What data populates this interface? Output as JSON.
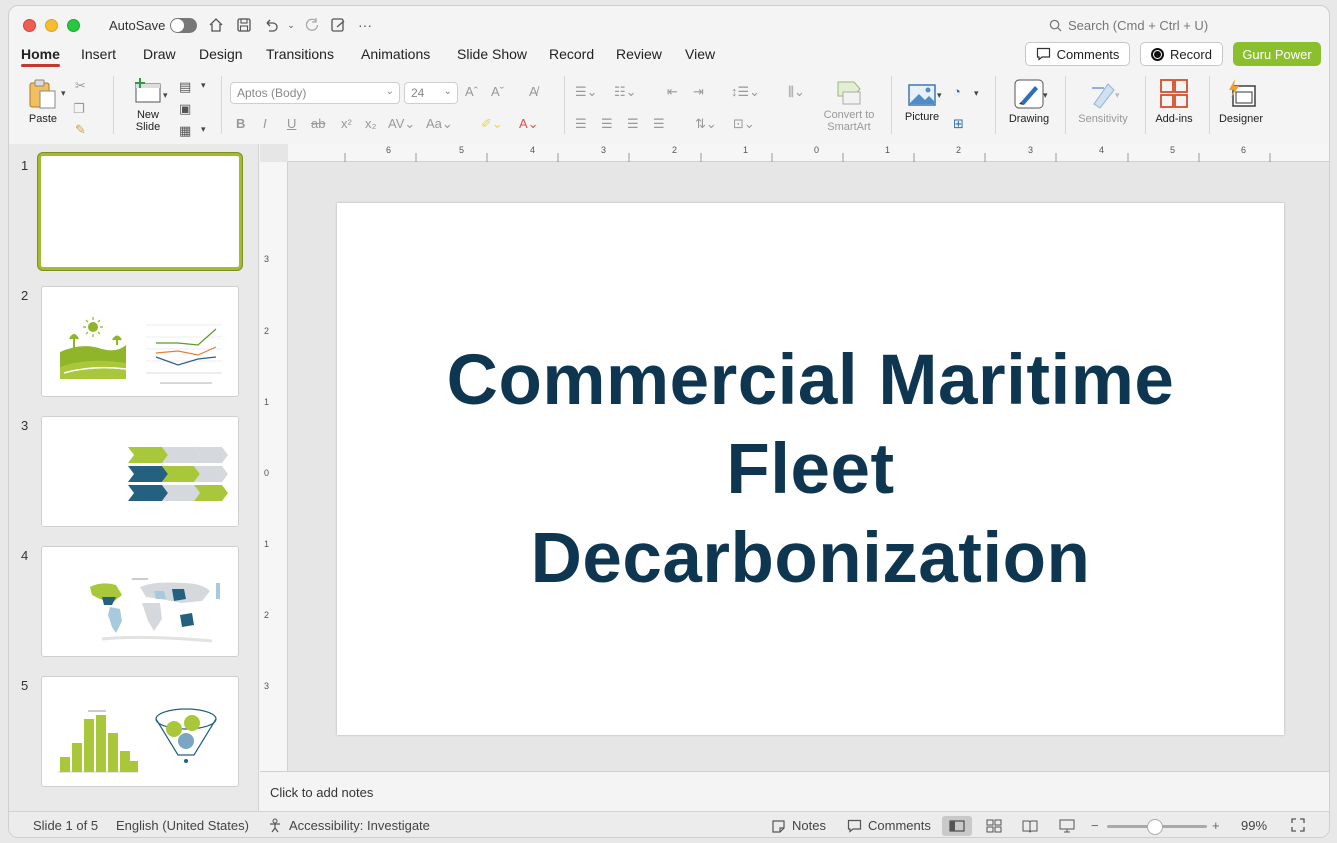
{
  "titlebar": {
    "autosave_label": "AutoSave",
    "search_placeholder": "Search (Cmd + Ctrl + U)"
  },
  "tabs": [
    "Home",
    "Insert",
    "Draw",
    "Design",
    "Transitions",
    "Animations",
    "Slide Show",
    "Record",
    "Review",
    "View"
  ],
  "header_buttons": {
    "comments": "Comments",
    "record": "Record",
    "guru": "Guru Power"
  },
  "ribbon": {
    "paste": "Paste",
    "new_slide_1": "New",
    "new_slide_2": "Slide",
    "font_name": "Aptos (Body)",
    "font_size": "24",
    "convert_1": "Convert to",
    "convert_2": "SmartArt",
    "picture": "Picture",
    "drawing": "Drawing",
    "sensitivity": "Sensitivity",
    "addins": "Add-ins",
    "designer": "Designer"
  },
  "slides": [
    {
      "num": "1"
    },
    {
      "num": "2"
    },
    {
      "num": "3"
    },
    {
      "num": "4"
    },
    {
      "num": "5"
    }
  ],
  "slide": {
    "title_line1": "Commercial Maritime",
    "title_line2": "Fleet",
    "title_line3": "Decarbonization"
  },
  "notes_placeholder": "Click to add notes",
  "ruler": {
    "h_ticks": [
      "6",
      "5",
      "4",
      "3",
      "2",
      "1",
      "0",
      "1",
      "2",
      "3",
      "4",
      "5",
      "6"
    ],
    "v_ticks": [
      "3",
      "2",
      "1",
      "0",
      "1",
      "2",
      "3"
    ]
  },
  "status": {
    "slide_count": "Slide 1 of 5",
    "language": "English (United States)",
    "accessibility": "Accessibility: Investigate",
    "notes": "Notes",
    "comments": "Comments",
    "zoom": "99%"
  },
  "colors": {
    "accent_green": "#8bbf2e",
    "title_navy": "#0e3650",
    "tab_underline": "#c4382e"
  }
}
